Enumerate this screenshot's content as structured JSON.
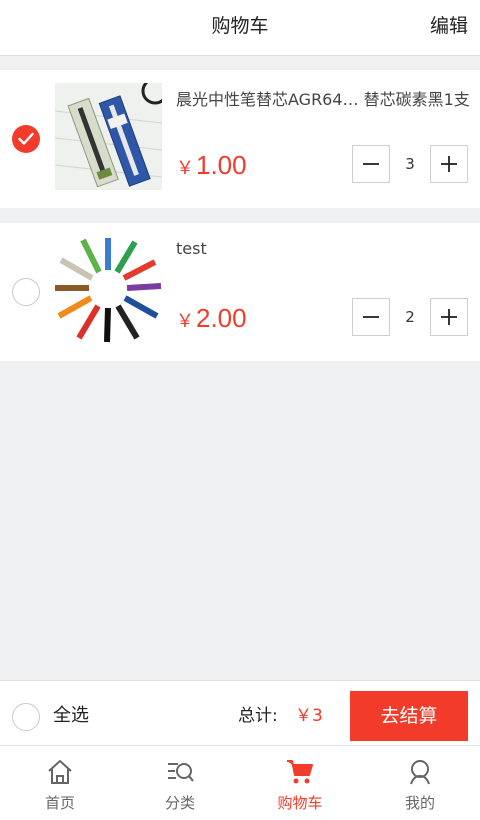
{
  "header": {
    "title": "购物车",
    "edit_label": "编辑"
  },
  "items": [
    {
      "name": "晨光中性笔替芯AGR64… 替芯碳素黑1支",
      "currency": "￥",
      "price": "1.00",
      "quantity": "3",
      "selected": true
    },
    {
      "name": "test",
      "currency": "￥",
      "price": "2.00",
      "quantity": "2",
      "selected": false
    }
  ],
  "summary": {
    "select_all_label": "全选",
    "total_label": "总计:",
    "total_value": "￥3",
    "checkout_label": "去结算"
  },
  "tabs": [
    {
      "label": "首页",
      "icon": "home-icon"
    },
    {
      "label": "分类",
      "icon": "category-search-icon"
    },
    {
      "label": "购物车",
      "icon": "cart-icon",
      "active": true
    },
    {
      "label": "我的",
      "icon": "profile-icon"
    }
  ],
  "colors": {
    "accent": "#f23b2a",
    "background": "#eef0f1"
  }
}
